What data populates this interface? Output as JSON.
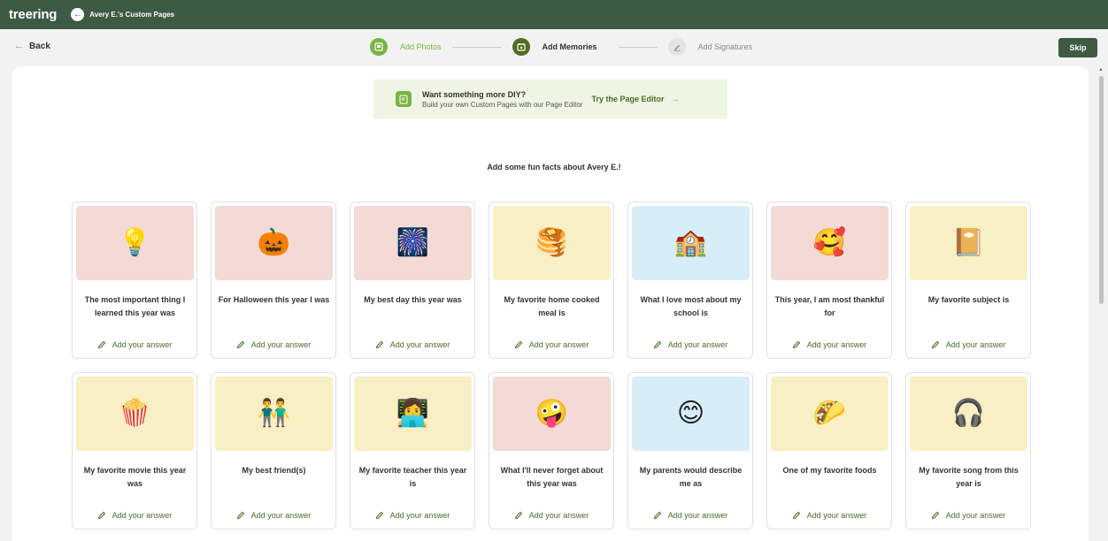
{
  "app": {
    "logo": "treering",
    "page_title": "Avery E.'s Custom Pages"
  },
  "nav": {
    "back_label": "Back",
    "skip_label": "Skip"
  },
  "steps": [
    {
      "label": "Add Photos",
      "state": "done"
    },
    {
      "label": "Add Memories",
      "state": "active"
    },
    {
      "label": "Add Signatures",
      "state": "todo"
    }
  ],
  "diy": {
    "title": "Want something more DIY?",
    "subtitle": "Build your own Custom Pages with our Page Editor",
    "link": "Try the Page Editor"
  },
  "heading": "Add some fun facts about Avery E.!",
  "answer_label": "Add your answer",
  "colors": {
    "brand": "#3d5a44",
    "accent": "#7ab344",
    "pink": "#f3dad6",
    "yellow": "#f9efc4",
    "blue": "#d7eef8"
  },
  "cards": [
    {
      "question": "The most important thing I learned this year was",
      "icon": "lightbulb-icon",
      "glyph": "💡",
      "bg": "pink"
    },
    {
      "question": "For Halloween this year I was",
      "icon": "jack-o-lantern-icon",
      "glyph": "🎃",
      "bg": "pink"
    },
    {
      "question": "My best day this year was",
      "icon": "fireworks-icon",
      "glyph": "🎆",
      "bg": "pink"
    },
    {
      "question": "My favorite home cooked meal is",
      "icon": "pancakes-icon",
      "glyph": "🥞",
      "bg": "yellow"
    },
    {
      "question": "What I love most about my school is",
      "icon": "school-icon",
      "glyph": "🏫",
      "bg": "blue"
    },
    {
      "question": "This year, I am most thankful for",
      "icon": "smiling-face-with-hearts-icon",
      "glyph": "🥰",
      "bg": "pink"
    },
    {
      "question": "My favorite subject is",
      "icon": "notebook-icon",
      "glyph": "📔",
      "bg": "yellow"
    },
    {
      "question": "My favorite movie this year was",
      "icon": "popcorn-icon",
      "glyph": "🍿",
      "bg": "yellow"
    },
    {
      "question": "My best friend(s)",
      "icon": "friends-icon",
      "glyph": "👬",
      "bg": "yellow"
    },
    {
      "question": "My favorite teacher this year is",
      "icon": "teacher-icon",
      "glyph": "👩‍💻",
      "bg": "yellow"
    },
    {
      "question": "What I'll never forget about this year was",
      "icon": "zany-face-icon",
      "glyph": "🤪",
      "bg": "pink"
    },
    {
      "question": "My parents would describe me as",
      "icon": "blushing-face-icon",
      "glyph": "😊",
      "bg": "blue"
    },
    {
      "question": "One of my favorite foods",
      "icon": "taco-icon",
      "glyph": "🌮",
      "bg": "yellow"
    },
    {
      "question": "My favorite song from this year is",
      "icon": "headphones-icon",
      "glyph": "🎧",
      "bg": "yellow"
    }
  ]
}
